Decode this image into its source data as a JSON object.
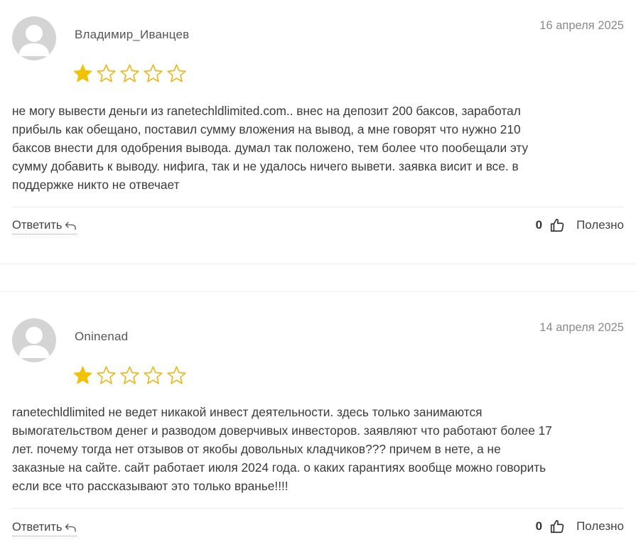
{
  "colors": {
    "star_filled": "#f2c100",
    "star_outline": "#e8b923",
    "avatar_bg": "#d4d4d4",
    "avatar_fg": "#ffffff"
  },
  "reviews": [
    {
      "author": "Владимир_Иванцев",
      "date": "16 апреля 2025",
      "rating": 1,
      "rating_max": 5,
      "text": "не могу вывести деньги из ranetechldlimited.com.. внес на депозит 200 баксов, заработал\nприбыль как обещано, поставил сумму вложения на вывод, а мне говорят что нужно 210\nбаксов внести для одобрения вывода. думал так положено, тем более что пообещали эту\nсумму добавить к выводу. нифига, так и не удалось ничего вывети. заявка висит и все. в\nподдержке никто не отвечает",
      "reply_label": "Ответить",
      "reply_icon": "reply-arrow-icon",
      "helpful_count": "0",
      "helpful_icon": "thumbs-up-icon",
      "helpful_label": "Полезно"
    },
    {
      "author": "Oninenad",
      "date": "14 апреля 2025",
      "rating": 1,
      "rating_max": 5,
      "text": "ranetechldlimited не ведет никакой инвест деятельности. здесь только занимаются\nвымогательством денег и разводом доверчивых инвесторов. заявляют что работают более 17\nлет. почему тогда нет отзывов от якобы довольных кладчиков??? причем в нете, а не\nзаказные на сайте. сайт работает июля 2024 года. о каких гарантиях вообще можно говорить\nесли все что рассказывают это только вранье!!!!",
      "reply_label": "Ответить",
      "reply_icon": "reply-arrow-icon",
      "helpful_count": "0",
      "helpful_icon": "thumbs-up-icon",
      "helpful_label": "Полезно"
    }
  ]
}
